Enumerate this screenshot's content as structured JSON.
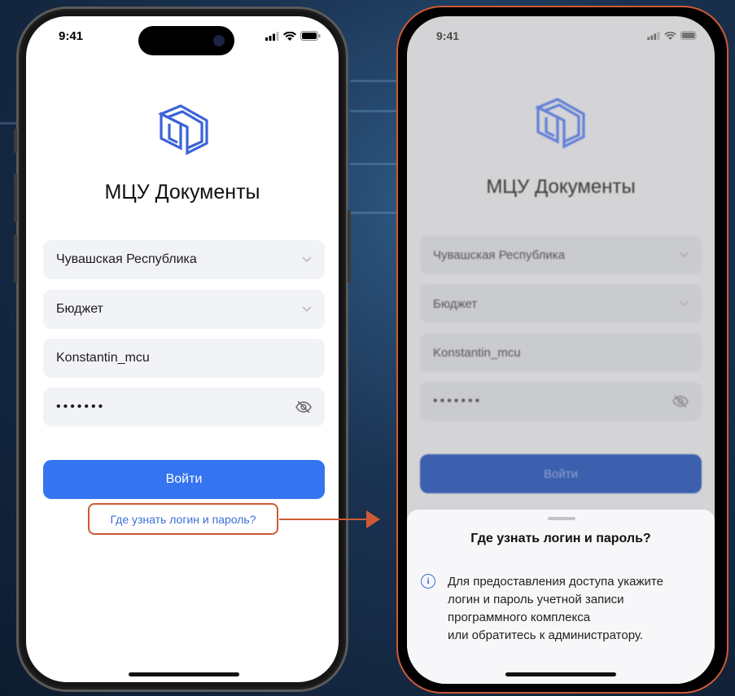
{
  "status_bar": {
    "time": "9:41"
  },
  "login_screen": {
    "app_title": "МЦУ Документы",
    "region": {
      "value": "Чувашская Республика"
    },
    "category": {
      "value": "Бюджет"
    },
    "username": {
      "value": "Konstantin_mcu"
    },
    "password": {
      "masked": "•••••••"
    },
    "login_button": "Войти",
    "help_link": "Где узнать логин и пароль?"
  },
  "help_sheet": {
    "title": "Где узнать логин и пароль?",
    "lines": [
      "Для предоставления доступа укажите",
      "логин и пароль учетной записи",
      "программного комплекса",
      "или обратитесь к администратору."
    ]
  },
  "colors": {
    "accent": "#3574f0",
    "highlight": "#cc5a34",
    "link": "#3a6fd6",
    "field_bg": "#f2f3f7"
  },
  "icons": [
    "logo-icon",
    "chevron-down-icon",
    "eye-off-icon",
    "info-icon",
    "signal-icon",
    "wifi-icon",
    "battery-icon"
  ]
}
